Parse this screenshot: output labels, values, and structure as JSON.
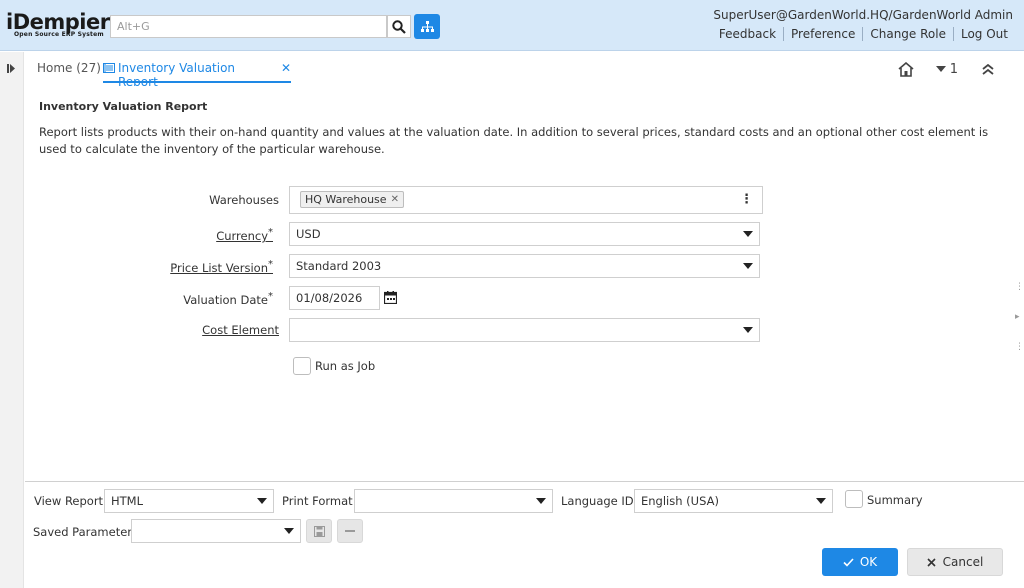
{
  "app": {
    "logo_main": "iDempiere",
    "logo_sub": "Open Source ERP System",
    "search_placeholder": "Alt+G",
    "user": "SuperUser@GardenWorld.HQ/GardenWorld Admin",
    "links": [
      "Feedback",
      "Preference",
      "Change Role",
      "Log Out"
    ]
  },
  "tabs": {
    "home": "Home (27)",
    "active": "Inventory Valuation Report",
    "close": "✕",
    "window_count": "1"
  },
  "report": {
    "title": "Inventory Valuation Report",
    "description": "Report lists products with their on-hand quantity and values at the valuation date. In addition to several prices, standard costs and an optional other cost element is used to calculate the inventory of the particular warehouse."
  },
  "params": {
    "warehouses_label": "Warehouses",
    "warehouses_chip": "HQ Warehouse",
    "currency_label": "Currency",
    "currency_value": "USD",
    "price_list_label": "Price List Version",
    "price_list_value": "Standard 2003",
    "valuation_date_label": "Valuation Date",
    "valuation_date_value": "01/08/2026",
    "cost_element_label": "Cost Element",
    "cost_element_value": "",
    "run_as_job_label": "Run as Job",
    "required_mark": "*"
  },
  "bottom": {
    "view_report_label": "View Report",
    "view_report_value": "HTML",
    "print_format_label": "Print Format",
    "print_format_value": "",
    "language_label": "Language ID",
    "language_value": "English (USA)",
    "summary_label": "Summary",
    "saved_params_label": "Saved Parameters",
    "saved_params_value": "",
    "ok_label": "OK",
    "cancel_label": "Cancel"
  },
  "colors": {
    "accent": "#1e88e5",
    "header_bg": "#d6e8f9"
  }
}
